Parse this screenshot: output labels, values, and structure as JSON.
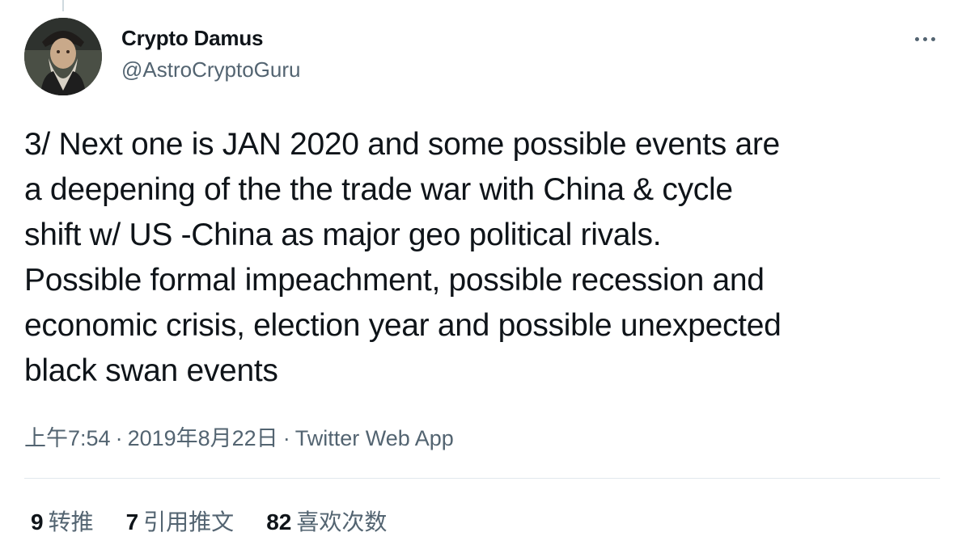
{
  "author": {
    "display_name": "Crypto Damus",
    "handle": "@AstroCryptoGuru",
    "avatar_icon": "bearded-man-portrait-avatar"
  },
  "tweet": {
    "text": "3/ Next one is JAN 2020 and some possible events are\na deepening of the the trade war with China & cycle\nshift w/ US -China as major geo political rivals.\nPossible formal impeachment, possible recession and\neconomic crisis, election year and possible unexpected\nblack swan events"
  },
  "meta": {
    "time": "上午7:54",
    "separator": "·",
    "date": "2019年8月22日",
    "source": "Twitter Web App"
  },
  "stats": {
    "retweets": {
      "count": "9",
      "label": "转推"
    },
    "quotes": {
      "count": "7",
      "label": "引用推文"
    },
    "likes": {
      "count": "82",
      "label": "喜欢次数"
    }
  },
  "icons": {
    "more": "more-horizontal-icon"
  },
  "colors": {
    "text_primary": "#0f1419",
    "text_secondary": "#536471",
    "divider": "#e1e8ed"
  }
}
